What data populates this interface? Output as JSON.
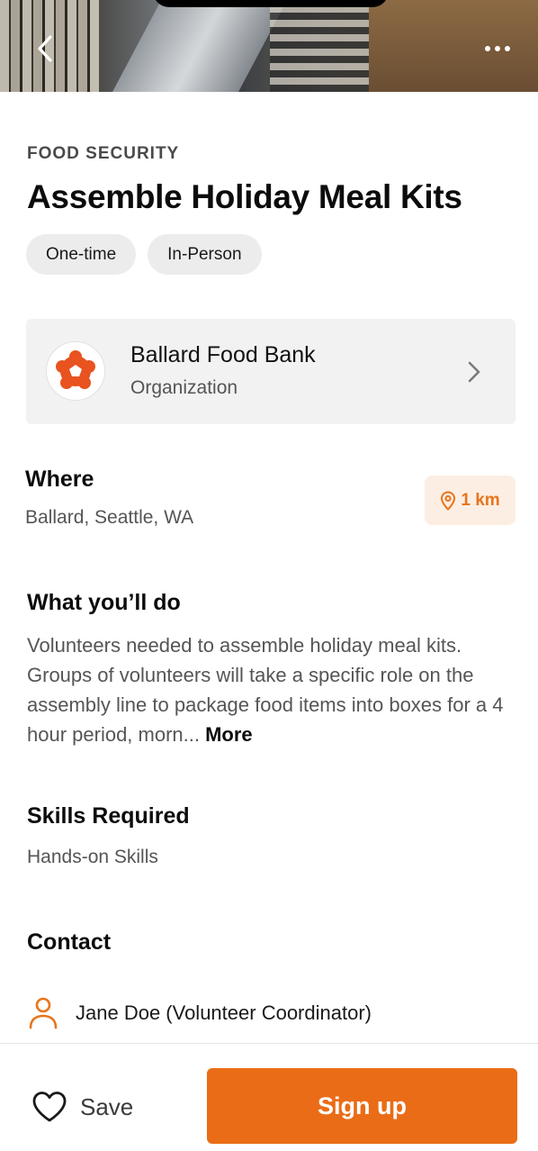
{
  "colors": {
    "accent": "#ea6c16",
    "accent_light": "#fdeee3",
    "text_primary": "#0c0c0c",
    "text_secondary": "#555555",
    "card_bg": "#f2f2f2",
    "tag_bg": "#ececec"
  },
  "header": {
    "back_icon": "chevron-left-icon",
    "more_icon": "more-horizontal-icon"
  },
  "opportunity": {
    "category": "FOOD SECURITY",
    "title": "Assemble Holiday Meal Kits",
    "tags": [
      "One-time",
      "In-Person"
    ]
  },
  "organization": {
    "name": "Ballard Food Bank",
    "type": "Organization",
    "logo_icon": "organization-logo-icon",
    "chevron_icon": "chevron-right-icon"
  },
  "where": {
    "label": "Where",
    "value": "Ballard, Seattle, WA",
    "distance": "1 km",
    "distance_icon": "map-pin-icon"
  },
  "what": {
    "label": "What you’ll do",
    "text": "Volunteers needed to assemble holiday meal kits. Groups of volunteers will take a specific role on the assembly line to package food items into boxes for a 4 hour period, morn...",
    "more_label": "More"
  },
  "skills": {
    "label": "Skills Required",
    "value": "Hands-on Skills"
  },
  "contact": {
    "label": "Contact",
    "name": "Jane Doe (Volunteer Coordinator)",
    "icon": "person-icon"
  },
  "footer": {
    "save_label": "Save",
    "save_icon": "heart-icon",
    "signup_label": "Sign up"
  }
}
